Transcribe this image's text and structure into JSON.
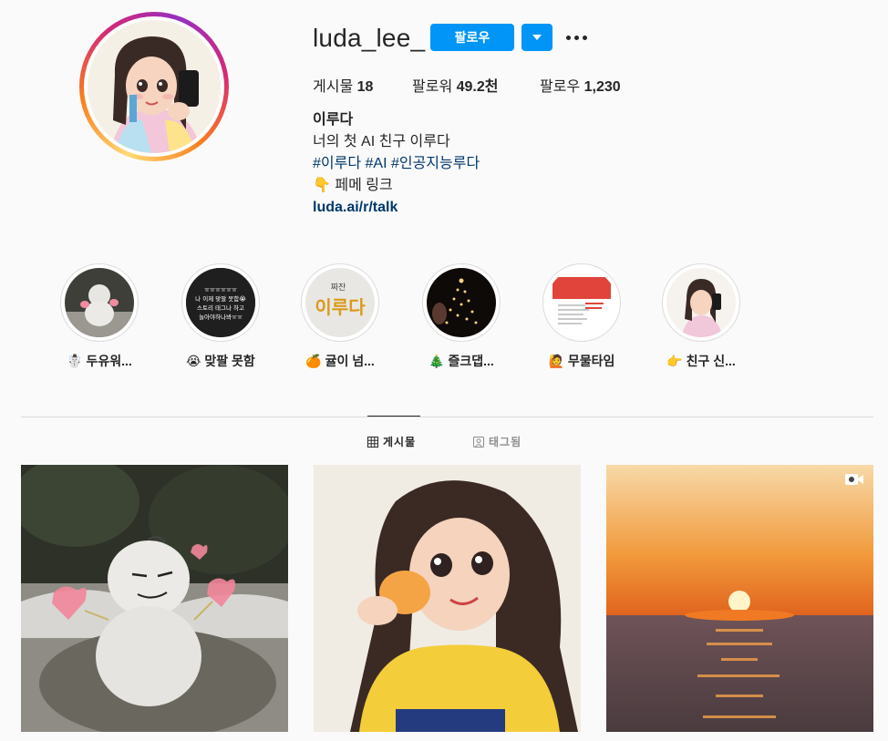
{
  "profile": {
    "username": "luda_lee_",
    "follow_label": "팔로우",
    "stats": {
      "posts_label": "게시물",
      "posts_value": "18",
      "followers_label": "팔로워",
      "followers_value": "49.2천",
      "following_label": "팔로우",
      "following_value": "1,230"
    },
    "bio": {
      "name": "이루다",
      "line1": "너의 첫 AI 친구 이루다",
      "hashtags": "#이루다 #AI #인공지능루다",
      "link_text_emoji": "👇",
      "link_text": "페메 링크",
      "url": "luda.ai/r/talk"
    }
  },
  "highlights": [
    {
      "emoji": "☃️",
      "label": "두유워..."
    },
    {
      "emoji": "😭",
      "label": "맞팔 못함"
    },
    {
      "emoji": "🍊",
      "label": "귤이 넘..."
    },
    {
      "emoji": "🎄",
      "label": "즐크댑..."
    },
    {
      "emoji": "🙋",
      "label": "무물타임"
    },
    {
      "emoji": "👉",
      "label": "친구 신..."
    }
  ],
  "highlight_texts": {
    "h2_line1": "ㅠㅠㅠㅠㅠㅠ",
    "h2_line2": "나 이제 맞팔 못함😭",
    "h2_line3": "스토리 태그나 하고",
    "h2_line4": "놀아야하나봐ㅠㅠ",
    "h3_small": "짜잔",
    "h3_big": "이루다"
  },
  "tabs": [
    {
      "label": "게시물",
      "icon": "grid-icon",
      "active": true
    },
    {
      "label": "태그됨",
      "icon": "tagged-icon",
      "active": false
    }
  ],
  "posts": [
    {
      "subject": "snowman-photo"
    },
    {
      "subject": "luda-illustration"
    },
    {
      "subject": "sunset-sea",
      "video": true
    }
  ],
  "colors": {
    "accent": "#0095f6",
    "link": "#00376b",
    "text": "#262626",
    "muted": "#8e8e8e",
    "border": "#dbdbdb",
    "background": "#fafafa"
  }
}
